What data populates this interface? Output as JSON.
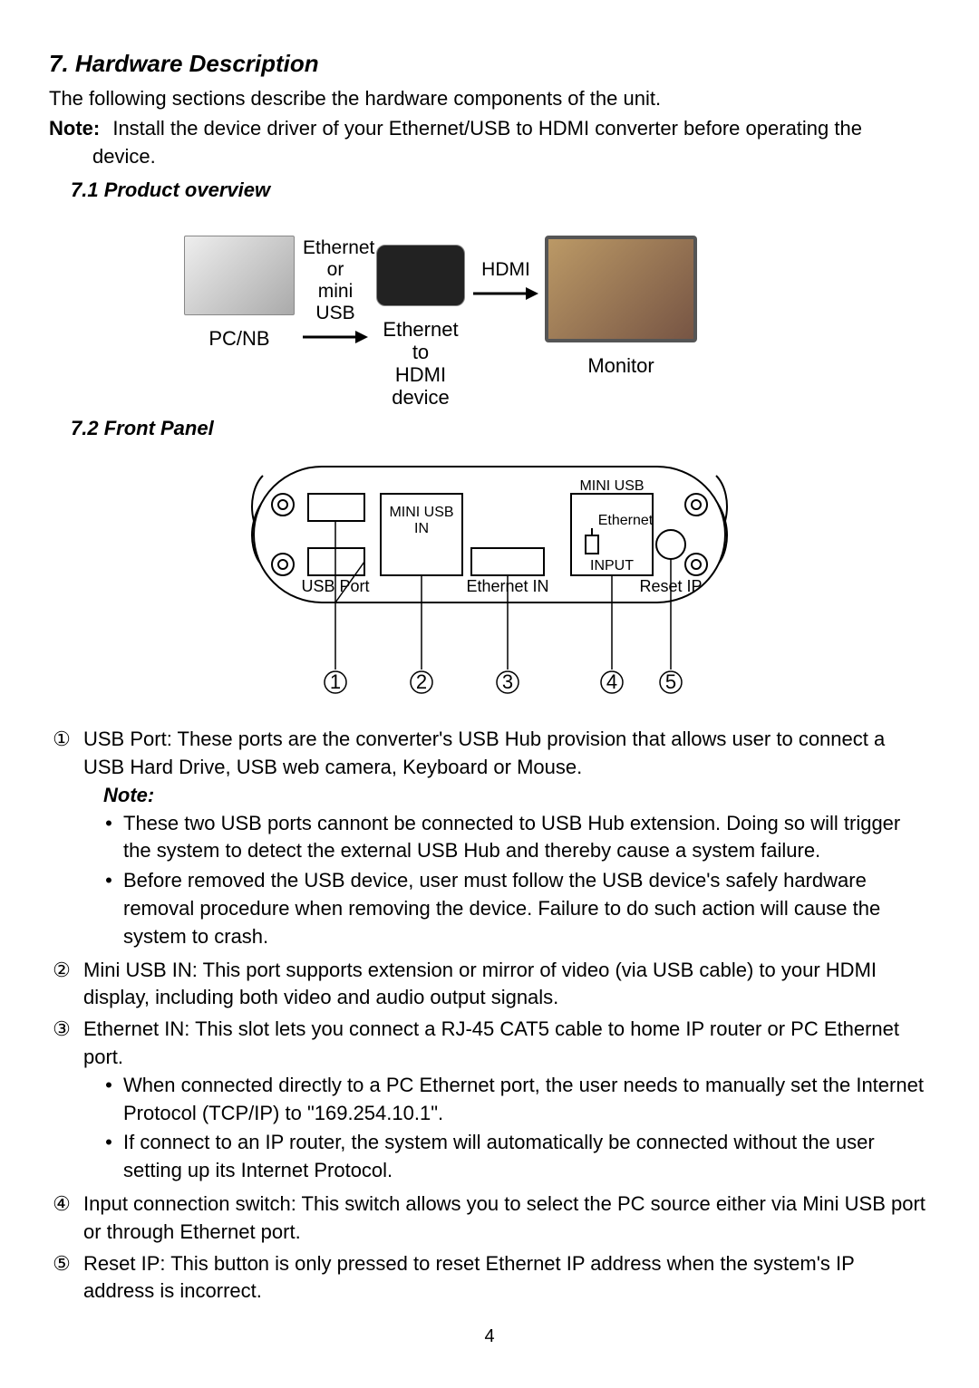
{
  "section": {
    "title": "7. Hardware Description",
    "intro": "The following sections describe the hardware components of the unit.",
    "note_label": "Note:",
    "note_text": " Install the device driver of your Ethernet/USB to HDMI converter before operating the device."
  },
  "sub71": {
    "title": "7.1 Product overview",
    "arrow1_top": "Ethernet or",
    "arrow1_bot": "mini USB",
    "arrow2_text": "HDMI",
    "pc_label": "PC/NB",
    "dev_label_1": "Ethernet to",
    "dev_label_2": "HDMI device",
    "mon_label": "Monitor"
  },
  "sub72": {
    "title": "7.2 Front Panel",
    "labels": {
      "mini_usb_top": "MINI USB",
      "mini_usb_in_1": "MINI USB",
      "mini_usb_in_2": "IN",
      "ethernet": "Ethernet",
      "input": "INPUT",
      "usb_port": "USB Port",
      "ethernet_in": "Ethernet IN",
      "reset_ip": "Reset IP"
    },
    "items": [
      {
        "num": "①",
        "text": "USB Port: These ports are the converter's USB Hub provision that allows user to connect a USB Hard Drive, USB web camera, Keyboard or Mouse.",
        "note_title": "Note:",
        "bullets": [
          "These two USB ports cannont be connected to USB Hub extension. Doing so will trigger the system to detect the external USB Hub and thereby cause a system failure.",
          "Before removed the USB device, user must follow the USB device's safely hardware removal procedure when removing the device. Failure to do such action will cause the system to crash."
        ]
      },
      {
        "num": "②",
        "text": "Mini USB IN: This port supports extension or mirror of video (via USB cable) to your HDMI display, including both video and audio output signals."
      },
      {
        "num": "③",
        "text": "Ethernet IN: This slot lets you connect a RJ-45 CAT5 cable to home IP router or PC Ethernet port.",
        "bullets": [
          "When connected directly to a PC Ethernet port, the user needs to manually set the Internet Protocol (TCP/IP) to \"169.254.10.1\".",
          "If connect to an IP router, the system will automatically be connected without the user setting up its Internet Protocol."
        ]
      },
      {
        "num": "④",
        "text": "Input connection switch: This switch allows you to select the PC source either via Mini USB port or through Ethernet port."
      },
      {
        "num": "⑤",
        "text": "Reset IP: This button is only pressed to reset Ethernet IP address when the system's IP address is incorrect."
      }
    ]
  },
  "page_number": "4"
}
